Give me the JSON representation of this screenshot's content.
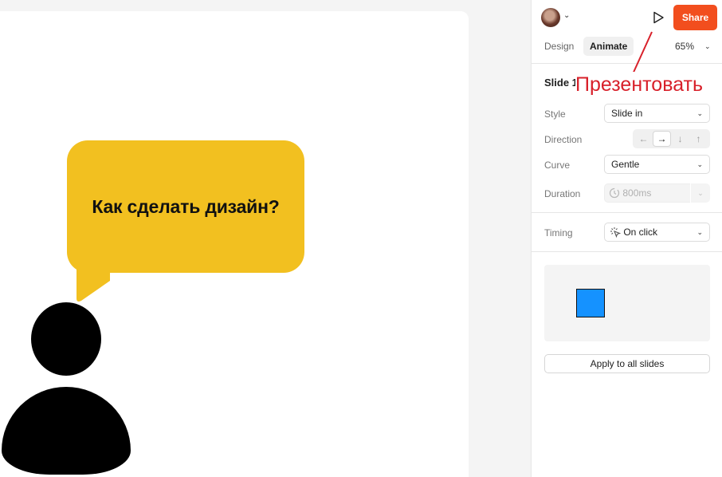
{
  "slide": {
    "bubble_text": "Как сделать дизайн?",
    "bubble_color": "#f2c020"
  },
  "header": {
    "avatar_icon": "user-avatar",
    "play_icon": "play-icon",
    "share_label": "Share",
    "share_color": "#f24e1e"
  },
  "tabs": {
    "design": "Design",
    "animate": "Animate",
    "active": "Animate"
  },
  "zoom": "65%",
  "animation": {
    "slide_title": "Slide 1",
    "style_label": "Style",
    "style_value": "Slide in",
    "direction_label": "Direction",
    "direction_options": [
      "←",
      "→",
      "↓",
      "↑"
    ],
    "direction_selected": "→",
    "curve_label": "Curve",
    "curve_value": "Gentle",
    "duration_label": "Duration",
    "duration_value": "800ms",
    "timing_label": "Timing",
    "timing_value": "On click"
  },
  "preview": {
    "square_color": "#1592ff"
  },
  "apply_label": "Apply to all slides",
  "annotation": {
    "text": "Презентовать",
    "color": "#d8202a"
  }
}
